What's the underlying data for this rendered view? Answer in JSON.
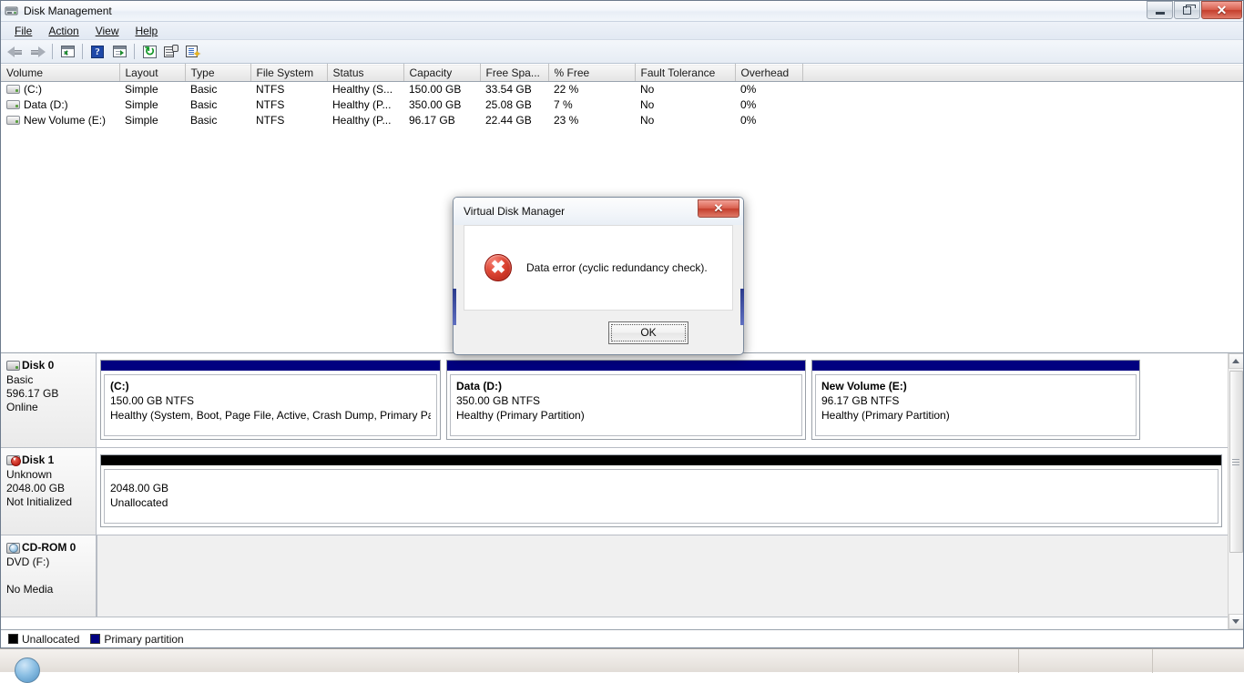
{
  "window": {
    "title": "Disk Management",
    "icon": "disk-management-icon",
    "controls": {
      "minimize": "–",
      "maximize": "❐",
      "close": "✕"
    }
  },
  "menu": {
    "items": [
      {
        "label": "File",
        "mnemonic": "F"
      },
      {
        "label": "Action",
        "mnemonic": "A"
      },
      {
        "label": "View",
        "mnemonic": "V"
      },
      {
        "label": "Help",
        "mnemonic": "H"
      }
    ]
  },
  "toolbar": {
    "buttons": [
      {
        "name": "back-icon",
        "title": "Back"
      },
      {
        "name": "forward-icon",
        "title": "Forward"
      },
      {
        "name": "up-one-level-icon",
        "title": "Up One Level"
      },
      {
        "name": "help-icon",
        "title": "Help"
      },
      {
        "name": "show-hide-console-tree-icon",
        "title": "Show/Hide Console Tree"
      },
      {
        "name": "refresh-icon",
        "title": "Refresh"
      },
      {
        "name": "properties-icon",
        "title": "Properties"
      },
      {
        "name": "rescan-disks-icon",
        "title": "Rescan Disks"
      }
    ]
  },
  "volume_table": {
    "columns": [
      "Volume",
      "Layout",
      "Type",
      "File System",
      "Status",
      "Capacity",
      "Free Spa...",
      "% Free",
      "Fault Tolerance",
      "Overhead"
    ],
    "rows": [
      {
        "volume": "(C:)",
        "layout": "Simple",
        "type": "Basic",
        "file_system": "NTFS",
        "status": "Healthy (S...",
        "capacity": "150.00 GB",
        "free_space": "33.54 GB",
        "percent_free": "22 %",
        "fault_tolerance": "No",
        "overhead": "0%"
      },
      {
        "volume": "Data (D:)",
        "layout": "Simple",
        "type": "Basic",
        "file_system": "NTFS",
        "status": "Healthy (P...",
        "capacity": "350.00 GB",
        "free_space": "25.08 GB",
        "percent_free": "7 %",
        "fault_tolerance": "No",
        "overhead": "0%"
      },
      {
        "volume": "New Volume (E:)",
        "layout": "Simple",
        "type": "Basic",
        "file_system": "NTFS",
        "status": "Healthy (P...",
        "capacity": "96.17 GB",
        "free_space": "22.44 GB",
        "percent_free": "23 %",
        "fault_tolerance": "No",
        "overhead": "0%"
      }
    ]
  },
  "graphical_view": {
    "disks": [
      {
        "name": "Disk 0",
        "type": "Basic",
        "size": "596.17 GB",
        "state": "Online",
        "icon": "hard-disk-icon",
        "partitions": [
          {
            "label": "(C:)",
            "size_fs": "150.00 GB NTFS",
            "status": "Healthy (System, Boot, Page File, Active, Crash Dump, Primary Partit",
            "kind": "primary"
          },
          {
            "label": "Data  (D:)",
            "size_fs": "350.00 GB NTFS",
            "status": "Healthy (Primary Partition)",
            "kind": "primary"
          },
          {
            "label": "New Volume  (E:)",
            "size_fs": "96.17 GB NTFS",
            "status": "Healthy (Primary Partition)",
            "kind": "primary"
          }
        ]
      },
      {
        "name": "Disk 1",
        "type": "Unknown",
        "size": "2048.00 GB",
        "state": "Not Initialized",
        "icon": "hard-disk-not-initialized-icon",
        "partitions": [
          {
            "label": "",
            "size_fs": "2048.00 GB",
            "status": "Unallocated",
            "kind": "unallocated"
          }
        ]
      },
      {
        "name": "CD-ROM 0",
        "type": "DVD (F:)",
        "size": "",
        "state": "No Media",
        "icon": "cd-rom-icon",
        "partitions": []
      }
    ]
  },
  "legend": {
    "items": [
      {
        "label": "Unallocated",
        "color": "#000000"
      },
      {
        "label": "Primary partition",
        "color": "#000080"
      }
    ]
  },
  "dialog": {
    "title": "Virtual Disk Manager",
    "message": "Data error (cyclic redundancy check).",
    "icon": "error-icon",
    "close_label": "✕",
    "ok_label": "OK"
  },
  "colors": {
    "primary_partition": "#000080",
    "unallocated": "#000000",
    "error_red": "#c0241a",
    "title_bar": "#f2f6fb"
  },
  "taskbar": {
    "start_label": "start-orb"
  }
}
